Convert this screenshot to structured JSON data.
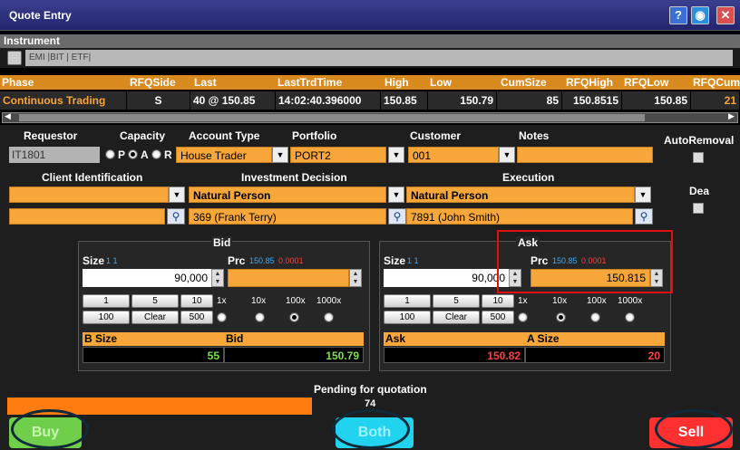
{
  "window": {
    "title": "Quote Entry",
    "help_icon": "help-icon",
    "globe_icon": "globe-icon",
    "close_icon": "close-icon"
  },
  "instrument": {
    "label": "Instrument",
    "value": "EMI |BIT | ETF|"
  },
  "table": {
    "headers": [
      "Phase",
      "RFQSide",
      "Last",
      "LastTrdTime",
      "High",
      "Low",
      "CumSize",
      "RFQHigh",
      "RFQLow",
      "RFQCum"
    ],
    "row": [
      "Continuous Trading",
      "S",
      "40 @ 150.85",
      "14:02:40.396000",
      "150.85",
      "150.79",
      "85",
      "150.8515",
      "150.85",
      "21"
    ]
  },
  "form": {
    "requestor_label": "Requestor",
    "requestor_value": "IT1801",
    "capacity_label": "Capacity",
    "capacity_options": [
      "P",
      "A",
      "R"
    ],
    "account_type_label": "Account Type",
    "account_type_value": "House Trader",
    "portfolio_label": "Portfolio",
    "portfolio_value": "PORT2",
    "customer_label": "Customer",
    "customer_value": "001",
    "notes_label": "Notes",
    "notes_value": "",
    "autoremoval_label": "AutoRemoval",
    "client_id_label": "Client Identification",
    "client_id_value": "",
    "client_id_value2": "",
    "investment_label": "Investment Decision",
    "investment_value": "Natural Person",
    "investment_person": "369 (Frank Terry)",
    "execution_label": "Execution",
    "execution_value": "Natural Person",
    "execution_person": "7891 (John Smith)",
    "dea_label": "Dea"
  },
  "bid": {
    "title": "Bid",
    "size_label": "Size",
    "size_hint": "1 1",
    "size_value": "90,000",
    "prc_label": "Prc",
    "prc_hint_a": "150.85",
    "prc_hint_b": "0.0001",
    "prc_value": "",
    "quick_row1": [
      "1",
      "5",
      "10"
    ],
    "quick_row2": [
      "100",
      "Clear",
      "500"
    ],
    "mult": [
      "1x",
      "10x",
      "100x",
      "1000x"
    ],
    "mult_selected": 2,
    "sum_size_label": "B Size",
    "sum_price_label": "Bid",
    "sum_size_value": "55",
    "sum_price_value": "150.79"
  },
  "ask": {
    "title": "Ask",
    "size_label": "Size",
    "size_hint": "1 1",
    "size_value": "90,000",
    "prc_label": "Prc",
    "prc_hint_a": "150.85",
    "prc_hint_b": "0.0001",
    "prc_value": "150.815",
    "quick_row1": [
      "1",
      "5",
      "10"
    ],
    "quick_row2": [
      "100",
      "Clear",
      "500"
    ],
    "mult": [
      "1x",
      "10x",
      "100x",
      "1000x"
    ],
    "mult_selected": 1,
    "sum_price_label": "Ask",
    "sum_size_label": "A Size",
    "sum_price_value": "150.82",
    "sum_size_value": "20"
  },
  "status": {
    "text": "Pending for quotation",
    "countdown": "74"
  },
  "actions": {
    "buy": "Buy",
    "both": "Both",
    "sell": "Sell"
  },
  "colors": {
    "orange": "#f7a63a",
    "buy": "#6fcf4a",
    "both": "#22d3f0",
    "sell": "#ff3030",
    "highlight": "#e01010"
  }
}
